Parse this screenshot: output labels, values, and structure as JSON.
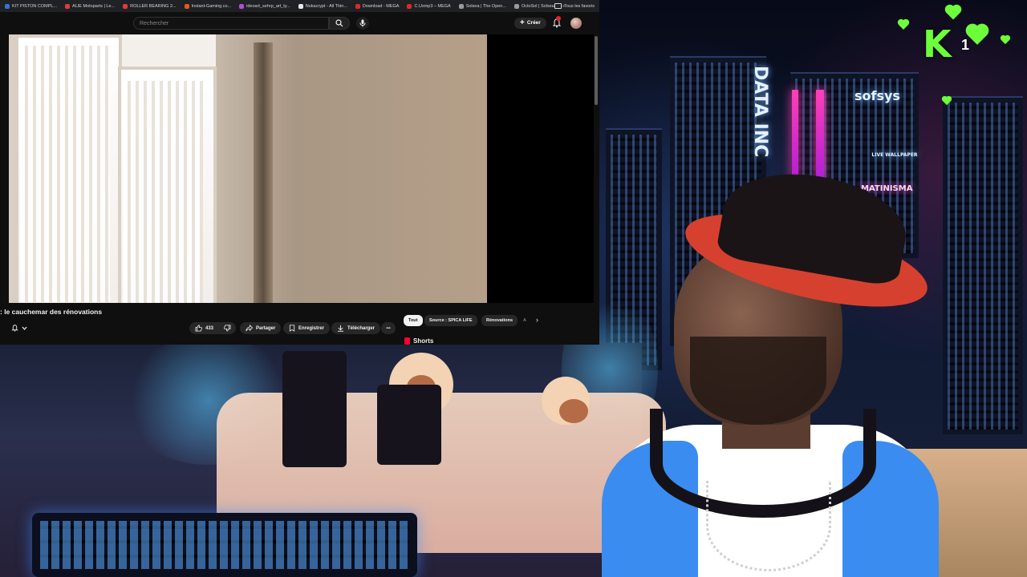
{
  "browser": {
    "bookmarks": [
      {
        "label": "KIT PISTON COMPL...",
        "color": "#3b6fd6"
      },
      {
        "label": "ALIE Motoparts | Le...",
        "color": "#e03a3a"
      },
      {
        "label": "ROLLER BEARING 2...",
        "color": "#e03a3a"
      },
      {
        "label": "Instant-Gaming.co...",
        "color": "#e05a1a"
      },
      {
        "label": "ideoart_sehrp_art_ty...",
        "color": "#b24dd6"
      },
      {
        "label": "Nokacrypt - All Thin...",
        "color": "#e8e8e8"
      },
      {
        "label": "Download - MEGA",
        "color": "#e0262c"
      },
      {
        "label": "C.Uxmp3 – MEGA",
        "color": "#e0262c"
      },
      {
        "label": "Solsea | The Open...",
        "color": "#9a9a9a"
      },
      {
        "label": "OctoSol | Solsea",
        "color": "#9a9a9a"
      }
    ],
    "overflow": "»",
    "all_bookmarks": "Tous les favoris"
  },
  "youtube": {
    "search_placeholder": "Rechercher",
    "create_label": "Créer",
    "video_title": ": le cauchemar des rénovations",
    "likes": "433",
    "share_label": "Partager",
    "save_label": "Enregistrer",
    "download_label": "Télécharger",
    "more_label": "•••",
    "chips": [
      "Tout",
      "Source : SPICA LIFE",
      "Rénovations",
      "A"
    ],
    "chips_next": "›",
    "shorts_label": "Shorts"
  },
  "overlay": {
    "logo_letter": "K",
    "logo_count": "1"
  },
  "scene": {
    "sign_data": "DATA INC",
    "sign_sys": "sofsys",
    "sign_matinisma": "MATINISMA",
    "sign_wall": "LIVE WALLPAPER"
  },
  "colors": {
    "accent_green": "#6cff3a",
    "youtube_red": "#ff0033",
    "hat_red": "#d5412e",
    "shirt_blue": "#3a8cf0"
  }
}
